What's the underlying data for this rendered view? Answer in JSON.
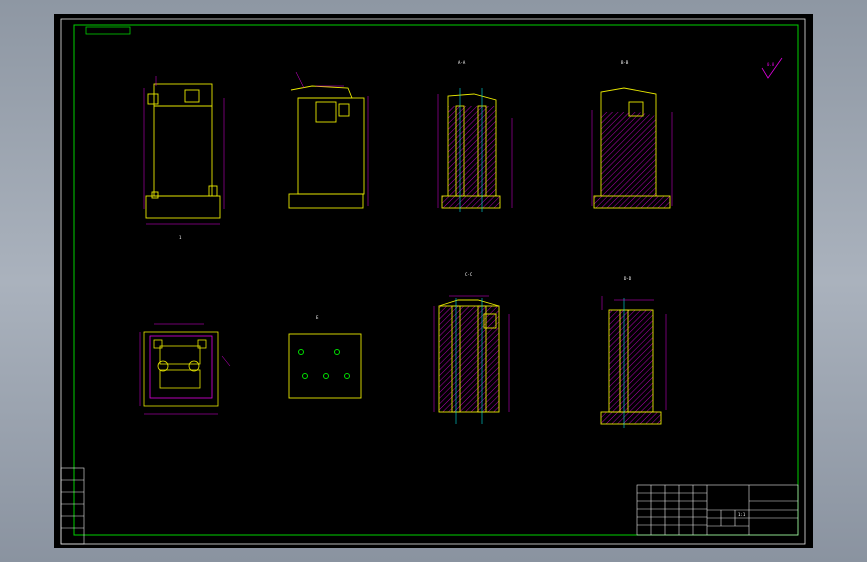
{
  "colors": {
    "background": "#000000",
    "frame": "#00d000",
    "outline": "#e8e800",
    "dimension": "#e000e0",
    "text": "#ffffff",
    "center_line": "#00e0e0",
    "hatch": "#e000e0"
  },
  "drawing": {
    "code_box_text": "",
    "roughness_symbol": "",
    "roughness_value": "0.8",
    "views": {
      "section_aa_label": "A-A",
      "section_bb_label": "B-B",
      "section_cc_label": "C-C",
      "section_dd_label": "D-D",
      "view_e_label": "E",
      "front_mark": "1"
    },
    "technical_notes": {
      "title": "",
      "lines": [
        "",
        "",
        "",
        ""
      ]
    },
    "title_block": {
      "part_name": "",
      "scale": "1:1",
      "drawing_no": "",
      "material": ""
    },
    "left_strip": {
      "items": [
        "",
        "",
        "",
        "",
        "",
        ""
      ]
    }
  }
}
